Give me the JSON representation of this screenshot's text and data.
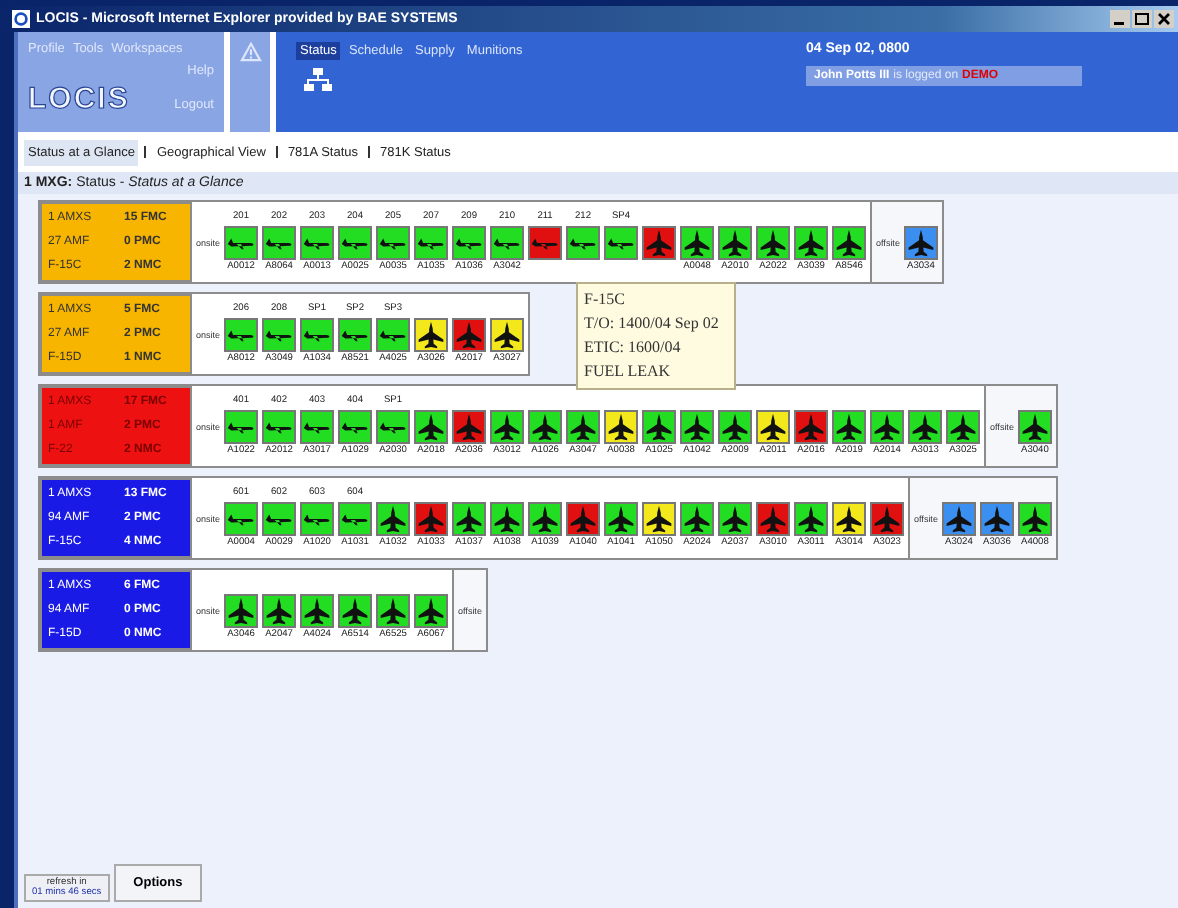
{
  "window": {
    "title": "LOCIS - Microsoft Internet Explorer provided by BAE SYSTEMS"
  },
  "app_menu": [
    "Profile",
    "Tools",
    "Workspaces",
    "Help"
  ],
  "logo": "LOCIS",
  "logout": "Logout",
  "nav_tabs": [
    {
      "label": "Status",
      "selected": true
    },
    {
      "label": "Schedule",
      "selected": false
    },
    {
      "label": "Supply",
      "selected": false
    },
    {
      "label": "Munitions",
      "selected": false
    }
  ],
  "datetime": "04 Sep 02, 0800",
  "user": {
    "name": "John Potts III",
    "text": "is logged on",
    "site": "DEMO"
  },
  "sub_tabs": [
    {
      "label": "Status at a Glance",
      "selected": true
    },
    {
      "label": "Geographical View",
      "selected": false
    },
    {
      "label": "781A Status",
      "selected": false
    },
    {
      "label": "781K Status",
      "selected": false
    }
  ],
  "breadcrumb": "**1 MXG:** Status - *Status at a Glance*",
  "groups": [
    {
      "color": "#f7b500",
      "summary": [
        [
          "1 AMXS",
          "15 FMC"
        ],
        [
          "27 AMF",
          "0 PMC"
        ],
        [
          "F-15C",
          "2 NMC"
        ]
      ],
      "onsite_label": "onsite",
      "offsite_label": "offsite",
      "onsite": [
        {
          "number": "201",
          "tail": "A0012",
          "kind": "flying",
          "color": "#22dd22"
        },
        {
          "number": "202",
          "tail": "A8064",
          "kind": "flying",
          "color": "#22dd22"
        },
        {
          "number": "203",
          "tail": "A0013",
          "kind": "flying",
          "color": "#22dd22"
        },
        {
          "number": "204",
          "tail": "A0025",
          "kind": "flying",
          "color": "#22dd22"
        },
        {
          "number": "205",
          "tail": "A0035",
          "kind": "flying",
          "color": "#22dd22"
        },
        {
          "number": "207",
          "tail": "A1035",
          "kind": "flying",
          "color": "#22dd22"
        },
        {
          "number": "209",
          "tail": "A1036",
          "kind": "flying",
          "color": "#22dd22"
        },
        {
          "number": "210",
          "tail": "A3042",
          "kind": "flying",
          "color": "#22dd22"
        },
        {
          "number": "211",
          "kind": "flying",
          "color": "#e01010"
        },
        {
          "number": "212",
          "kind": "flying",
          "color": "#22dd22"
        },
        {
          "number": "SP4",
          "kind": "flying",
          "color": "#22dd22"
        },
        {
          "kind": "parked",
          "color": "#e01010"
        },
        {
          "tail": "A0048",
          "kind": "parked",
          "color": "#22dd22"
        },
        {
          "tail": "A2010",
          "kind": "parked",
          "color": "#22dd22"
        },
        {
          "tail": "A2022",
          "kind": "parked",
          "color": "#22dd22"
        },
        {
          "tail": "A3039",
          "kind": "parked",
          "color": "#22dd22"
        },
        {
          "tail": "A8546",
          "kind": "parked",
          "color": "#22dd22"
        }
      ],
      "offsite": [
        {
          "tail": "A3034",
          "kind": "parked",
          "color": "#3b8ff0"
        }
      ]
    },
    {
      "color": "#f7b500",
      "summary": [
        [
          "1 AMXS",
          "5 FMC"
        ],
        [
          "27 AMF",
          "2 PMC"
        ],
        [
          "F-15D",
          "1 NMC"
        ]
      ],
      "onsite_label": "onsite",
      "onsite": [
        {
          "number": "206",
          "tail": "A8012",
          "kind": "flying",
          "color": "#22dd22"
        },
        {
          "number": "208",
          "tail": "A3049",
          "kind": "flying",
          "color": "#22dd22"
        },
        {
          "number": "SP1",
          "tail": "A1034",
          "kind": "flying",
          "color": "#22dd22"
        },
        {
          "number": "SP2",
          "tail": "A8521",
          "kind": "flying",
          "color": "#22dd22"
        },
        {
          "number": "SP3",
          "tail": "A4025",
          "kind": "flying",
          "color": "#22dd22"
        },
        {
          "tail": "A3026",
          "kind": "parked",
          "color": "#f2e81c"
        },
        {
          "tail": "A2017",
          "kind": "parked",
          "color": "#e01010"
        },
        {
          "tail": "A3027",
          "kind": "parked",
          "color": "#f2e81c"
        }
      ]
    },
    {
      "color": "#ee1111",
      "summary": [
        [
          "1 AMXS",
          "17 FMC"
        ],
        [
          "1 AMF",
          "2 PMC"
        ],
        [
          "F-22",
          "2 NMC"
        ]
      ],
      "onsite_label": "onsite",
      "offsite_label": "offsite",
      "onsite": [
        {
          "number": "401",
          "tail": "A1022",
          "kind": "flying",
          "color": "#22dd22"
        },
        {
          "number": "402",
          "tail": "A2012",
          "kind": "flying",
          "color": "#22dd22"
        },
        {
          "number": "403",
          "tail": "A3017",
          "kind": "flying",
          "color": "#22dd22"
        },
        {
          "number": "404",
          "tail": "A1029",
          "kind": "flying",
          "color": "#22dd22"
        },
        {
          "number": "SP1",
          "tail": "A2030",
          "kind": "flying",
          "color": "#22dd22"
        },
        {
          "tail": "A2018",
          "kind": "parked",
          "color": "#22dd22"
        },
        {
          "tail": "A2036",
          "kind": "parked",
          "color": "#e01010"
        },
        {
          "tail": "A3012",
          "kind": "parked",
          "color": "#22dd22"
        },
        {
          "tail": "A1026",
          "kind": "parked",
          "color": "#22dd22"
        },
        {
          "tail": "A3047",
          "kind": "parked",
          "color": "#22dd22"
        },
        {
          "tail": "A0038",
          "kind": "parked",
          "color": "#f2e81c"
        },
        {
          "tail": "A1025",
          "kind": "parked",
          "color": "#22dd22"
        },
        {
          "tail": "A1042",
          "kind": "parked",
          "color": "#22dd22"
        },
        {
          "tail": "A2009",
          "kind": "parked",
          "color": "#22dd22"
        },
        {
          "tail": "A2011",
          "kind": "parked",
          "color": "#f2e81c"
        },
        {
          "tail": "A2016",
          "kind": "parked",
          "color": "#e01010"
        },
        {
          "tail": "A2019",
          "kind": "parked",
          "color": "#22dd22"
        },
        {
          "tail": "A2014",
          "kind": "parked",
          "color": "#22dd22"
        },
        {
          "tail": "A3013",
          "kind": "parked",
          "color": "#22dd22"
        },
        {
          "tail": "A3025",
          "kind": "parked",
          "color": "#22dd22"
        }
      ],
      "offsite": [
        {
          "tail": "A3040",
          "kind": "parked",
          "color": "#22dd22"
        }
      ]
    },
    {
      "color": "#1a1ae6",
      "summary": [
        [
          "1 AMXS",
          "13 FMC"
        ],
        [
          "94 AMF",
          "2 PMC"
        ],
        [
          "F-15C",
          "4 NMC"
        ]
      ],
      "onsite_label": "onsite",
      "offsite_label": "offsite",
      "onsite": [
        {
          "number": "601",
          "tail": "A0004",
          "kind": "flying",
          "color": "#22dd22"
        },
        {
          "number": "602",
          "tail": "A0029",
          "kind": "flying",
          "color": "#22dd22"
        },
        {
          "number": "603",
          "tail": "A1020",
          "kind": "flying",
          "color": "#22dd22"
        },
        {
          "number": "604",
          "tail": "A1031",
          "kind": "flying",
          "color": "#22dd22"
        },
        {
          "tail": "A1032",
          "kind": "parked",
          "color": "#22dd22"
        },
        {
          "tail": "A1033",
          "kind": "parked",
          "color": "#e01010"
        },
        {
          "tail": "A1037",
          "kind": "parked",
          "color": "#22dd22"
        },
        {
          "tail": "A1038",
          "kind": "parked",
          "color": "#22dd22"
        },
        {
          "tail": "A1039",
          "kind": "parked",
          "color": "#22dd22"
        },
        {
          "tail": "A1040",
          "kind": "parked",
          "color": "#e01010"
        },
        {
          "tail": "A1041",
          "kind": "parked",
          "color": "#22dd22"
        },
        {
          "tail": "A1050",
          "kind": "parked",
          "color": "#f2e81c"
        },
        {
          "tail": "A2024",
          "kind": "parked",
          "color": "#22dd22"
        },
        {
          "tail": "A2037",
          "kind": "parked",
          "color": "#22dd22"
        },
        {
          "tail": "A3010",
          "kind": "parked",
          "color": "#e01010"
        },
        {
          "tail": "A3011",
          "kind": "parked",
          "color": "#22dd22"
        },
        {
          "tail": "A3014",
          "kind": "parked",
          "color": "#f2e81c"
        },
        {
          "tail": "A3023",
          "kind": "parked",
          "color": "#e01010"
        }
      ],
      "offsite": [
        {
          "tail": "A3024",
          "kind": "parked",
          "color": "#3b8ff0"
        },
        {
          "tail": "A3036",
          "kind": "parked",
          "color": "#3b8ff0"
        },
        {
          "tail": "A4008",
          "kind": "parked",
          "color": "#22dd22"
        }
      ]
    },
    {
      "color": "#1a1ae6",
      "summary": [
        [
          "1 AMXS",
          "6 FMC"
        ],
        [
          "94 AMF",
          "0 PMC"
        ],
        [
          "F-15D",
          "0 NMC"
        ]
      ],
      "onsite_label": "onsite",
      "offsite_label": "offsite",
      "onsite": [
        {
          "tail": "A3046",
          "kind": "parked",
          "color": "#22dd22"
        },
        {
          "tail": "A2047",
          "kind": "parked",
          "color": "#22dd22"
        },
        {
          "tail": "A4024",
          "kind": "parked",
          "color": "#22dd22"
        },
        {
          "tail": "A6514",
          "kind": "parked",
          "color": "#22dd22"
        },
        {
          "tail": "A6525",
          "kind": "parked",
          "color": "#22dd22"
        },
        {
          "tail": "A6067",
          "kind": "parked",
          "color": "#22dd22"
        }
      ]
    }
  ],
  "tooltip": [
    "F-15C",
    "T/O: 1400/04 Sep 02",
    "ETIC: 1600/04",
    "FUEL LEAK"
  ],
  "refresh": {
    "label": "refresh in",
    "countdown": "01 mins 46 secs"
  },
  "options_button": "Options"
}
